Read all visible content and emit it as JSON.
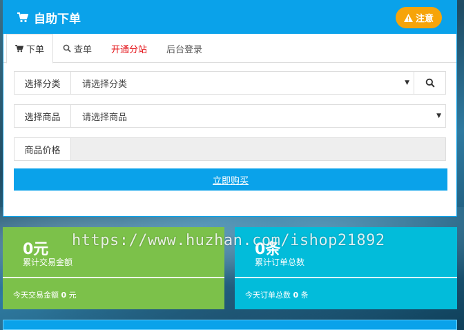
{
  "header": {
    "title": "自助下单",
    "notice_label": "注意"
  },
  "tabs": [
    {
      "label": "下单"
    },
    {
      "label": "查单"
    },
    {
      "label": "开通分站"
    },
    {
      "label": "后台登录"
    }
  ],
  "form": {
    "category_label": "选择分类",
    "category_value": "请选择分类",
    "product_label": "选择商品",
    "product_value": "请选择商品",
    "price_label": "商品价格",
    "price_value": ""
  },
  "buy_button_label": "立即购买",
  "stats": {
    "amount": {
      "value": "0元",
      "caption": "累计交易金额",
      "today_prefix": "今天交易金额",
      "today_value": "0",
      "today_unit": "元"
    },
    "orders": {
      "value": "0条",
      "caption": "累计订单总数",
      "today_prefix": "今天订单总数",
      "today_value": "0",
      "today_unit": "条"
    }
  },
  "watermark": "https://www.huzhan.com/ishop21892",
  "icons": {
    "cart": "shopping-cart-icon",
    "warning": "warning-icon",
    "search": "search-icon",
    "caret": "caret-down-icon"
  },
  "colors": {
    "primary": "#0aa2ea",
    "notice": "#f6a40a",
    "green": "#7cc14a",
    "cyan": "#02bcda",
    "red_link": "#e4141a"
  }
}
